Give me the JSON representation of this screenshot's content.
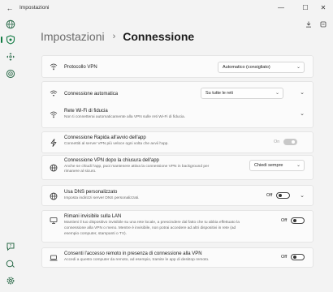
{
  "window": {
    "title": "Impostazioni",
    "back_glyph": "←",
    "minimize_glyph": "—",
    "maximize_glyph": "☐",
    "close_glyph": "✕"
  },
  "rail": [
    {
      "icon": "globe-icon"
    },
    {
      "icon": "shield-icon",
      "active": true
    },
    {
      "icon": "move-icon"
    },
    {
      "icon": "target-icon"
    },
    {
      "icon": "help-icon"
    },
    {
      "icon": "feedback-icon"
    },
    {
      "icon": "settings-icon"
    }
  ],
  "header": {
    "breadcrumb": "Impostazioni",
    "separator": "›",
    "title": "Connessione"
  },
  "settings": {
    "protocol": {
      "title": "Protocollo VPN",
      "value": "Automatico (consigliato)"
    },
    "auto_connect": {
      "title": "Connessione automatica",
      "value": "Su tutte le reti"
    },
    "trusted_wifi": {
      "title": "Rete Wi-Fi di fiducia",
      "desc": "Non ti connetterai automaticamente alla VPN sulle reti Wi-Fi di fiducia."
    },
    "quick_connect": {
      "title": "Connessione Rapida all'avvio dell'app",
      "desc": "Connettiti al server VPN più veloce ogni volta che avvii l'app.",
      "toggle_label": "On",
      "enabled": true,
      "disabled": true
    },
    "keep_alive": {
      "title": "Connessione VPN dopo la chiusura dell'app",
      "desc_lines": [
        "Anche se chiudi l'app, puoi mantenere attiva la connessione VPN in background per",
        "rimanere al sicuro."
      ],
      "value": "Chiedi sempre"
    },
    "custom_dns": {
      "title": "Usa DNS personalizzato",
      "desc": "Imposta indirizzi server DNS personalizzati.",
      "toggle_label": "Off",
      "enabled": false
    },
    "lan_invisible": {
      "title": "Rimani invisibile sulla LAN",
      "desc_lines": [
        "Mantieni il tuo dispositivo invisibile su una rete locale, a prescindere dal fatto che tu abbia effettuato la",
        "connessione alla VPN o meno. Mentre è invisibile, non potrai accedere ad altri dispositivi in rete (ad",
        "esempio computer, stampanti o TV)."
      ],
      "toggle_label": "Off",
      "enabled": false
    },
    "remote_access": {
      "title": "Consenti l'accesso remoto in presenza di connessione alla VPN",
      "desc": "Accedi a questo computer da remoto, ad esempio, tramite le app di desktop remoto.",
      "toggle_label": "Off",
      "enabled": false
    }
  },
  "glyphs": {
    "dropdown": "⌄",
    "expand": "⌄"
  },
  "colors": {
    "accent": "#117a42",
    "background": "#f3f3f3",
    "card": "#fbfbfb"
  }
}
